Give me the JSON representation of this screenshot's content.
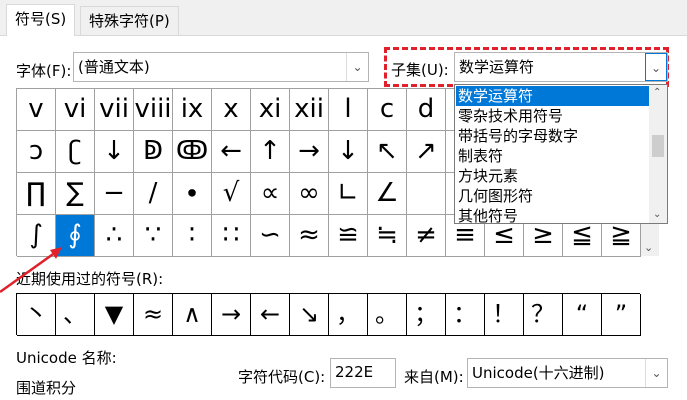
{
  "tabs": [
    {
      "label": "符号(S)",
      "active": true
    },
    {
      "label": "特殊字符(P)",
      "active": false
    }
  ],
  "font": {
    "label": "字体(F):",
    "value": "(普通文本)"
  },
  "subset": {
    "label": "子集(U):",
    "value": "数学运算符",
    "options": [
      "数学运算符",
      "零杂技术用符号",
      "带括号的字母数字",
      "制表符",
      "方块元素",
      "几何图形符",
      "其他符号"
    ]
  },
  "symbols": [
    [
      "v",
      "vi",
      "vii",
      "viii",
      "ix",
      "x",
      "xi",
      "xii",
      "l",
      "c",
      "d",
      "",
      "",
      "",
      "",
      ""
    ],
    [
      "ↄ",
      "ʗ",
      "↓",
      "ↁ",
      "ↂ",
      "←",
      "↑",
      "→",
      "↓",
      "↖",
      "↗",
      "",
      "",
      "",
      "",
      ""
    ],
    [
      "∏",
      "∑",
      "−",
      "∕",
      "∙",
      "√",
      "∝",
      "∞",
      "∟",
      "∠",
      "",
      "",
      "",
      "",
      "",
      ""
    ],
    [
      "∫",
      "∮",
      "∴",
      "∵",
      "∶",
      "∷",
      "∽",
      "≈",
      "≌",
      "≒",
      "≠",
      "≡",
      "≤",
      "≥",
      "≦",
      "≧"
    ]
  ],
  "selected_symbol": "∮",
  "recent": {
    "label": "近期使用过的符号(R):",
    "symbols": [
      "丶",
      "、",
      "▼",
      "≈",
      "∧",
      "→",
      "←",
      "↘",
      "，",
      "。",
      "；",
      "：",
      "！",
      "？",
      "“",
      "”"
    ]
  },
  "unicode_name": {
    "label": "Unicode 名称:",
    "value": "围道积分"
  },
  "char_code": {
    "label": "字符代码(C):",
    "value": "222E"
  },
  "from": {
    "label": "来自(M):",
    "value": "Unicode(十六进制)"
  },
  "colors": {
    "accent": "#0078d7",
    "highlight": "#e0202a"
  }
}
